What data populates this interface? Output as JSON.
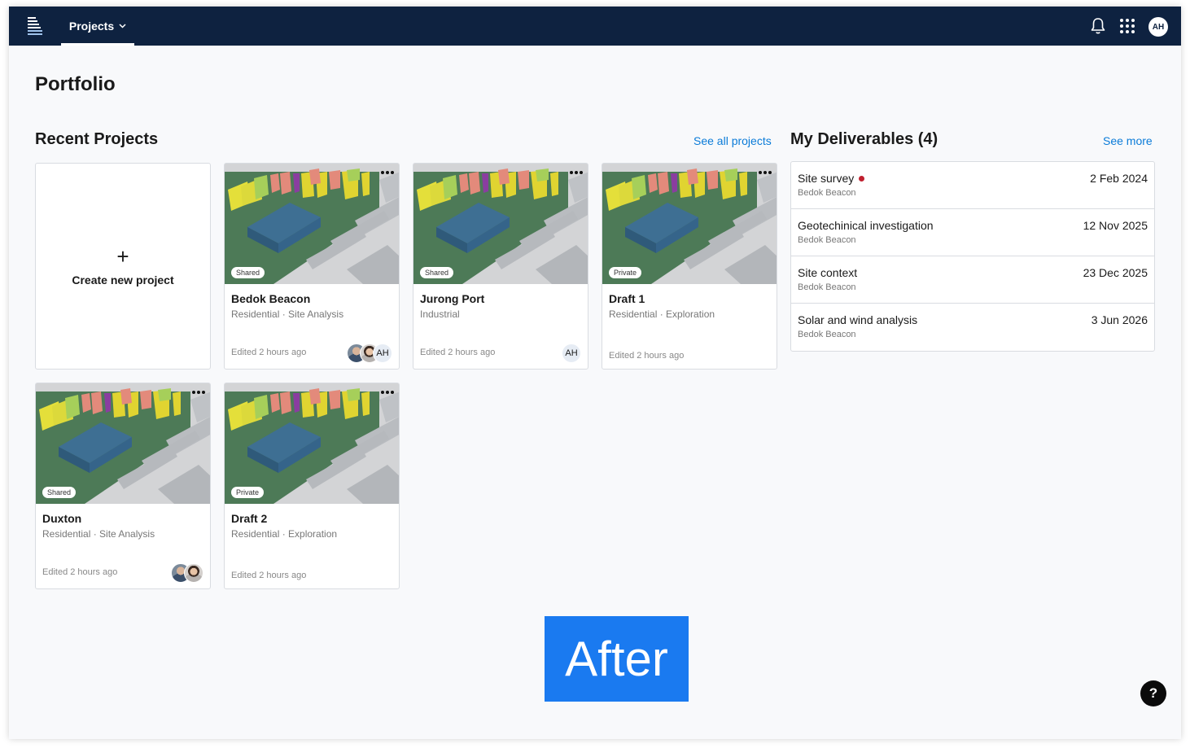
{
  "nav": {
    "projects_label": "Projects",
    "avatar_initials": "AH"
  },
  "page": {
    "title": "Portfolio"
  },
  "recent": {
    "title": "Recent Projects",
    "see_all": "See all projects",
    "create_label": "Create new project",
    "projects": [
      {
        "name": "Bedok Beacon",
        "sub": "Residential · Site Analysis",
        "badge": "Shared",
        "edited": "Edited 2 hours ago",
        "avatar_initials": "AH"
      },
      {
        "name": "Jurong Port",
        "sub": "Industrial",
        "badge": "Shared",
        "edited": "Edited 2 hours ago",
        "avatar_initials": "AH"
      },
      {
        "name": "Draft 1",
        "sub": "Residential · Exploration",
        "badge": "Private",
        "edited": "Edited 2 hours ago"
      },
      {
        "name": "Duxton",
        "sub": "Residential · Site Analysis",
        "badge": "Shared",
        "edited": "Edited 2 hours ago"
      },
      {
        "name": "Draft 2",
        "sub": "Residential · Exploration",
        "badge": "Private",
        "edited": "Edited 2 hours ago"
      }
    ]
  },
  "deliverables": {
    "title": "My Deliverables (4)",
    "see_more": "See more",
    "items": [
      {
        "name": "Site survey",
        "project": "Bedok Beacon",
        "date": "2 Feb 2024",
        "alert": true
      },
      {
        "name": "Geotechinical investigation",
        "project": "Bedok Beacon",
        "date": "12 Nov 2025"
      },
      {
        "name": "Site context",
        "project": "Bedok Beacon",
        "date": "23 Dec 2025"
      },
      {
        "name": "Solar and wind analysis",
        "project": "Bedok Beacon",
        "date": "3 Jun 2026"
      }
    ]
  },
  "overlay": {
    "after_label": "After"
  },
  "help": {
    "label": "?"
  },
  "colors": {
    "topbar": "#0e2240",
    "link": "#0a7bd8",
    "alert_dot": "#c0202f",
    "after_bg": "#1a7af0"
  }
}
